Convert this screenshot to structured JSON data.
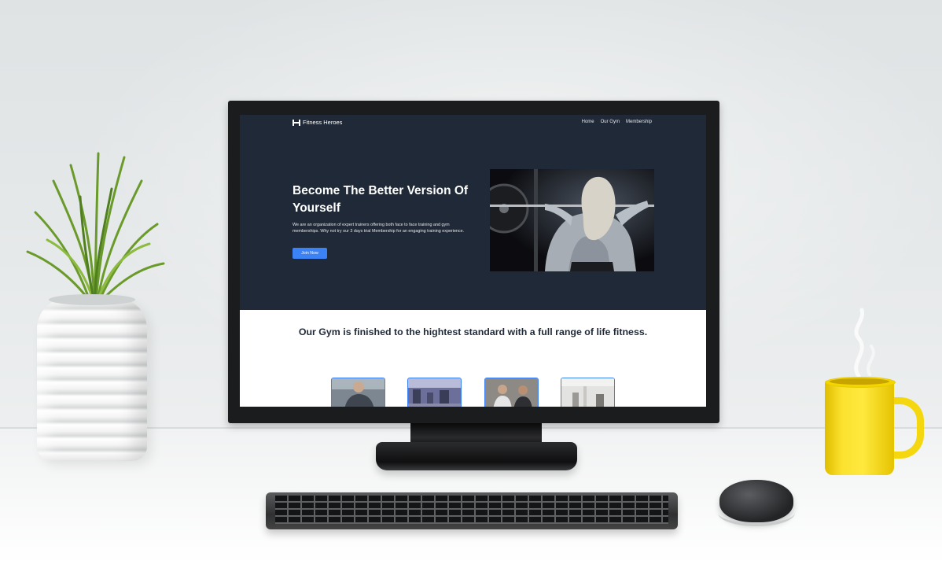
{
  "website": {
    "logo": "Fitness Heroes",
    "nav": [
      "Home",
      "Our Gym",
      "Membership"
    ],
    "hero": {
      "title": "Become The Better Version Of Yourself",
      "text": "We are an organization of expert trainers offering both face to face training and gym memberships. Why not try our 3 days trial Membership for an engaging training experience.",
      "button": "Join Now"
    },
    "section_title": "Our Gym is finished to the hightest standard with a full range of life fitness.",
    "gallery_count": 4
  },
  "colors": {
    "hero_bg": "#1f2937",
    "accent": "#3b82f6",
    "mug": "#fbe22f"
  },
  "icons": [
    "dumbbell-logo-icon"
  ]
}
